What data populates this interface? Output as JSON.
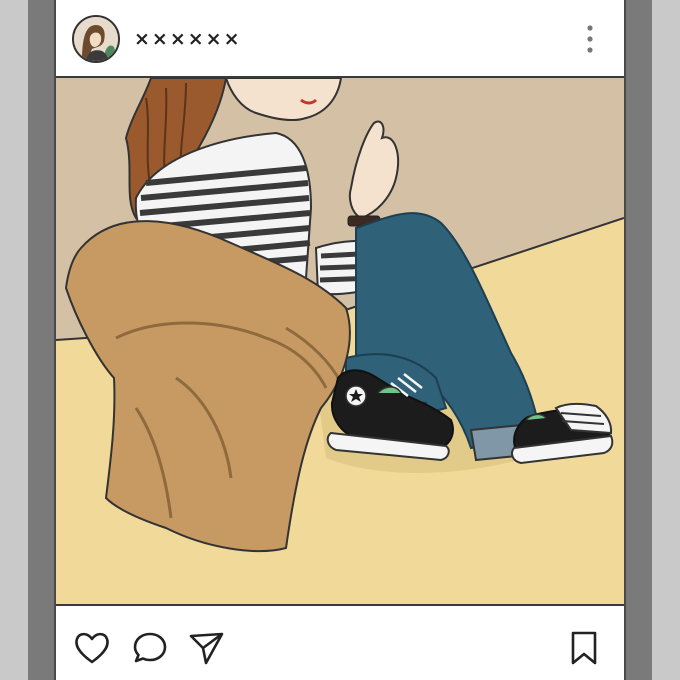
{
  "post": {
    "username": "××××××",
    "image_description_icon": "illustration-photo"
  },
  "header": {
    "avatar_icon": "user-avatar",
    "more_icon": "vertical-dots-icon"
  },
  "actions": {
    "like_icon": "heart-icon",
    "comment_icon": "comment-bubble-icon",
    "share_icon": "paper-plane-icon",
    "save_icon": "bookmark-icon"
  },
  "colors": {
    "frame": "#7a7a7a",
    "wall": "#d3c0a5",
    "floor": "#f1d99a",
    "coat": "#c79a63",
    "jeans": "#2f6178",
    "shoe": "#1c1c1c"
  }
}
